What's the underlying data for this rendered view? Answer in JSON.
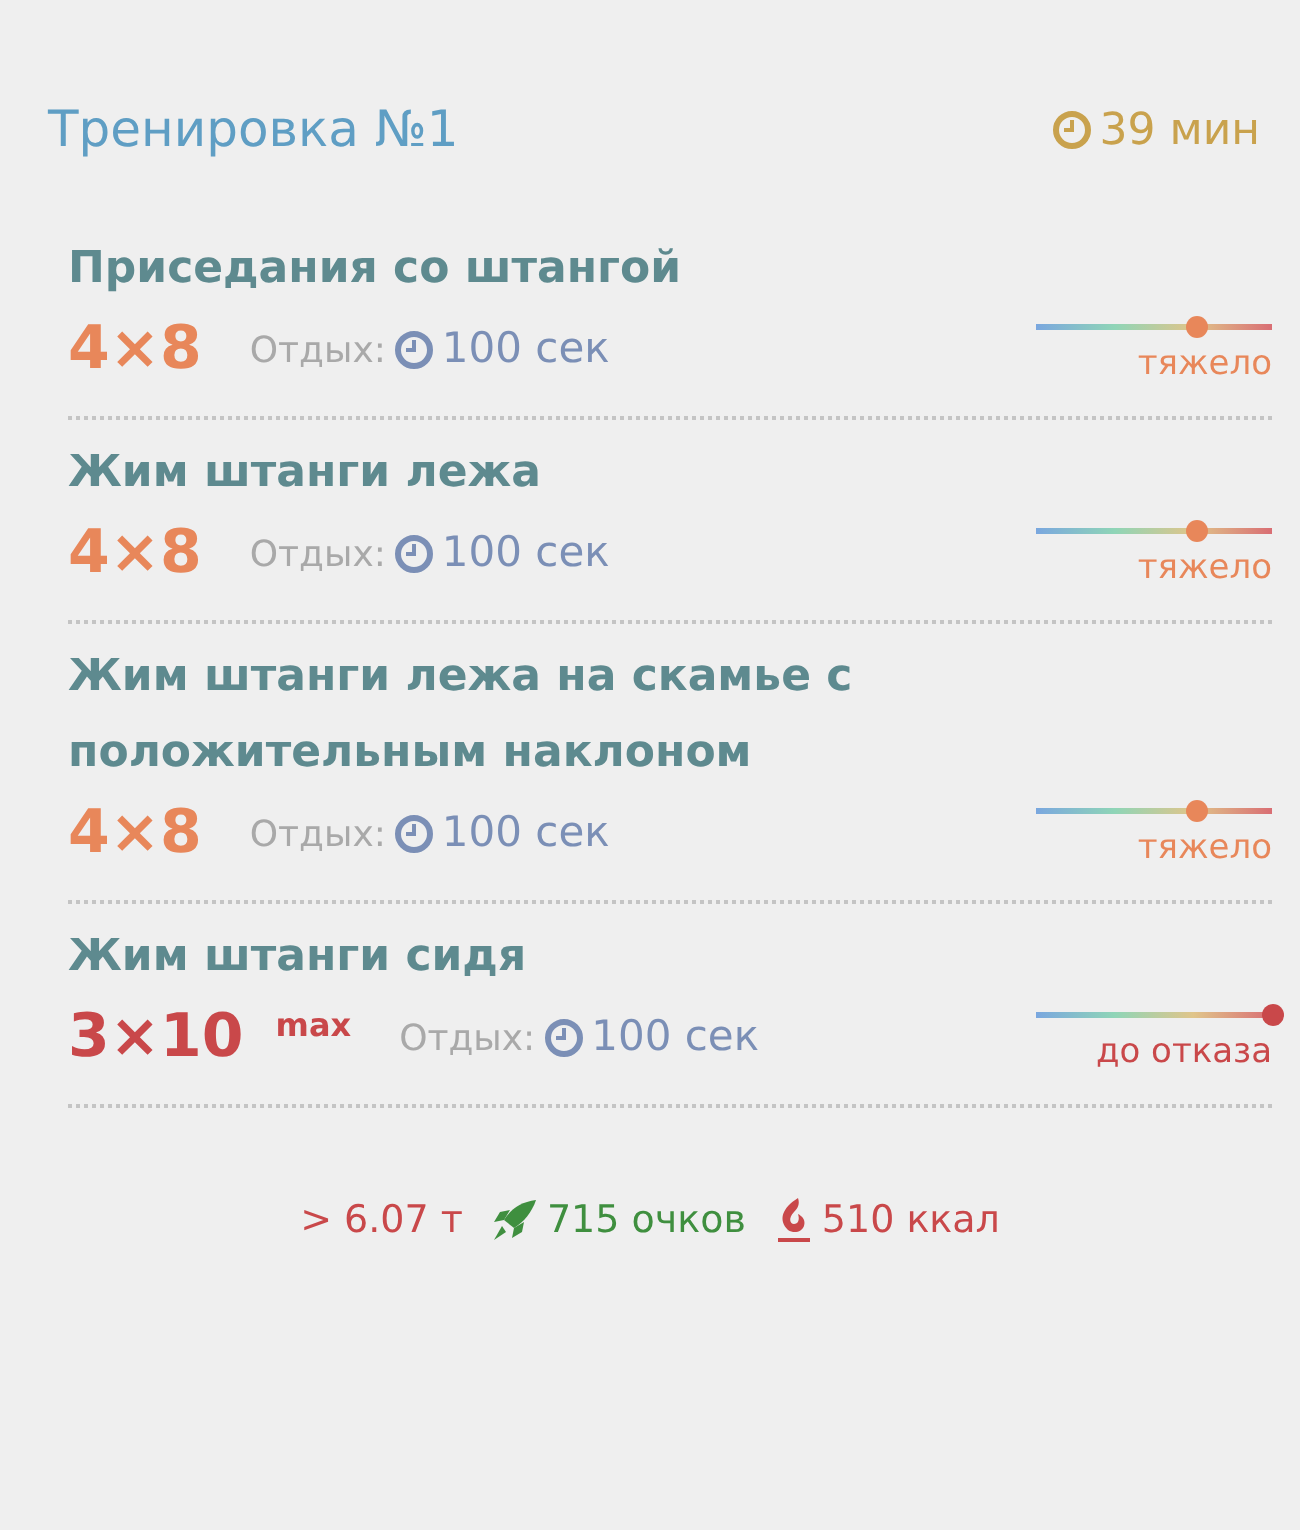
{
  "header": {
    "title": "Тренировка №1",
    "duration": "39 мин"
  },
  "exercises": [
    {
      "name": "Приседания со штангой",
      "sets": "4×8",
      "rest_label": "Отдых:",
      "rest": "100 сек",
      "color": "#e8875a",
      "intensity": {
        "label": "тяжело",
        "level": 0.68
      }
    },
    {
      "name": "Жим штанги лежа",
      "sets": "4×8",
      "rest_label": "Отдых:",
      "rest": "100 сек",
      "color": "#e8875a",
      "intensity": {
        "label": "тяжело",
        "level": 0.68
      }
    },
    {
      "name": "Жим штанги лежа на скамье с положительным наклоном",
      "sets": "4×8",
      "rest_label": "Отдых:",
      "rest": "100 сек",
      "color": "#e8875a",
      "intensity": {
        "label": "тяжело",
        "level": 0.68
      }
    },
    {
      "name": "Жим штанги сидя",
      "sets": "3×10",
      "sets_note": "max",
      "rest_label": "Отдых:",
      "rest": "100 сек",
      "color": "#c9484a",
      "intensity": {
        "label": "до отказа",
        "level": 1
      }
    }
  ],
  "summary": {
    "tonnage": "> 6.07 т",
    "points": "715 очков",
    "calories": "510 ккал"
  }
}
